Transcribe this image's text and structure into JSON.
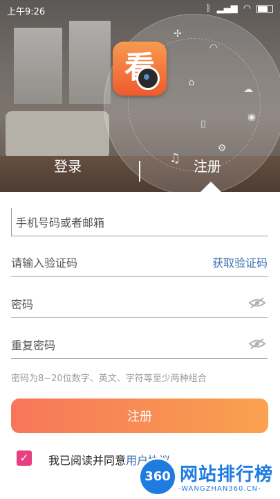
{
  "status_bar": {
    "time": "上午9:26"
  },
  "tabs": {
    "login": "登录",
    "register": "注册"
  },
  "fields": {
    "phone_placeholder": "手机号码或者邮箱",
    "code_placeholder": "请输入验证码",
    "get_code": "获取验证码",
    "password_placeholder": "密码",
    "repeat_password_placeholder": "重复密码"
  },
  "hint": "密码为8~20位数字、英文、字符等至少两种组合",
  "register_button": "注册",
  "agreement": {
    "text": "我已阅读并同意",
    "link": "用户协议",
    "checked": true
  },
  "watermark": {
    "badge": "360",
    "title": "网站排行榜",
    "subtitle": "-WANGZHAN360.CN-"
  },
  "colors": {
    "accent": "#3a6fb0",
    "button_start": "#f7765a",
    "button_end": "#f9a24f",
    "checkbox": "#e83e82"
  }
}
